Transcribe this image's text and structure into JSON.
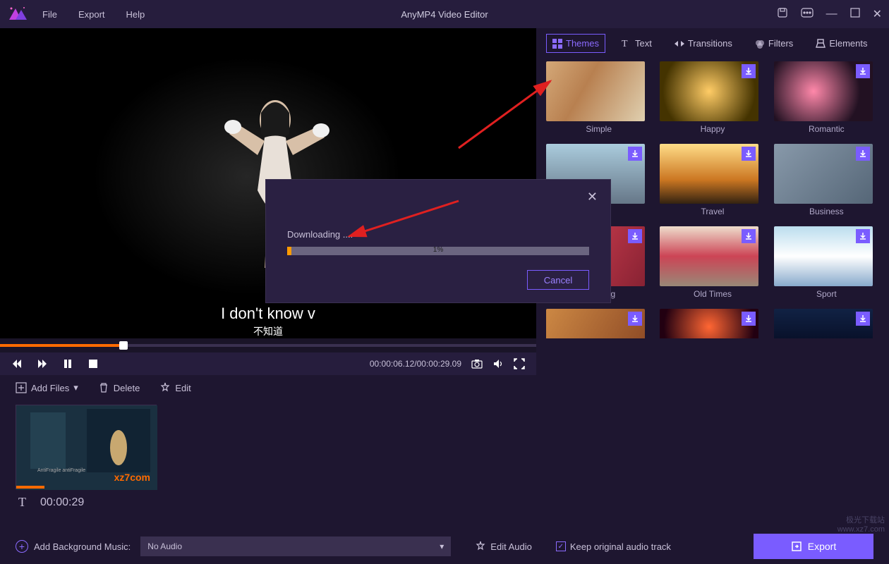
{
  "app": {
    "title": "AnyMP4 Video Editor"
  },
  "menu": {
    "file": "File",
    "export": "Export",
    "help": "Help"
  },
  "tabs": {
    "themes": "Themes",
    "text": "Text",
    "transitions": "Transitions",
    "filters": "Filters",
    "elements": "Elements"
  },
  "themes": [
    {
      "label": "Simple"
    },
    {
      "label": "Happy"
    },
    {
      "label": "Romantic"
    },
    {
      "label": ""
    },
    {
      "label": "Travel"
    },
    {
      "label": "Business"
    },
    {
      "label": "Wedding"
    },
    {
      "label": "Old Times"
    },
    {
      "label": "Sport"
    },
    {
      "label": ""
    },
    {
      "label": ""
    },
    {
      "label": ""
    }
  ],
  "preview": {
    "subtitle": "I don't know v"
  },
  "playback": {
    "timecode": "00:00:06.12/00:00:29.09",
    "seek_percent": 23
  },
  "toolbar": {
    "add_files": "Add Files",
    "delete": "Delete",
    "edit": "Edit"
  },
  "clip": {
    "duration": "00:00:29",
    "watermark": "xz7com",
    "caption": "AntiFragile antiFragile"
  },
  "footer": {
    "bgm_label": "Add Background Music:",
    "audio_value": "No Audio",
    "edit_audio": "Edit Audio",
    "keep_original": "Keep original audio track",
    "export": "Export"
  },
  "modal": {
    "label": "Downloading ....",
    "percent": "1%",
    "cancel": "Cancel"
  }
}
